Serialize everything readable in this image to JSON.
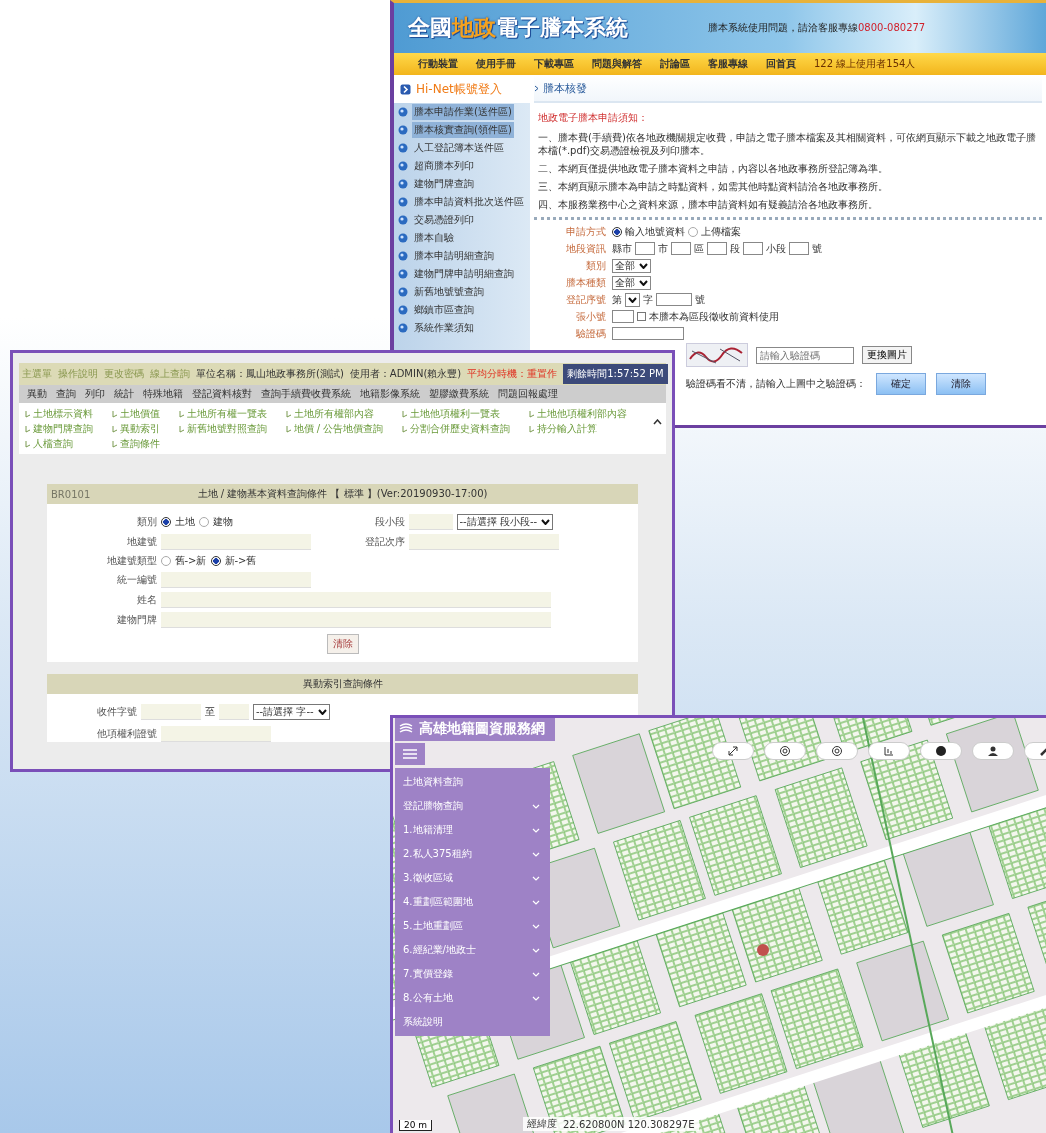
{
  "ecert_window": {
    "title_parts": [
      {
        "text": "全國",
        "accent": false
      },
      {
        "text": "地政",
        "accent": true
      },
      {
        "text": "電子謄本系統",
        "accent": false
      }
    ],
    "banner_note": "謄本系統使用問題，請洽客服專線",
    "banner_phone": "0800-080277",
    "nav": [
      "行動裝置",
      "使用手冊",
      "下載專區",
      "問題與解答",
      "討論區",
      "客服專線",
      "回首頁"
    ],
    "nav_note": "122 線上使用者154人",
    "login": "Hi-Net帳號登入",
    "sidebar": [
      {
        "label": "謄本申請作業(送件區)",
        "selected": true
      },
      {
        "label": "謄本核實查詢(領件區)",
        "selected": true
      },
      {
        "label": "人工登記簿本送件區",
        "selected": false
      },
      {
        "label": "超商謄本列印",
        "selected": false
      },
      {
        "label": "建物門牌查詢",
        "selected": false
      },
      {
        "label": "謄本申請資料批次送件區",
        "selected": false
      },
      {
        "label": "交易憑證列印",
        "selected": false
      },
      {
        "label": "謄本自驗",
        "selected": false
      },
      {
        "label": "謄本申請明細查詢",
        "selected": false
      },
      {
        "label": "建物門牌申請明細查詢",
        "selected": false
      },
      {
        "label": "新舊地號號查詢",
        "selected": false
      },
      {
        "label": "鄉鎮市區查詢",
        "selected": false
      },
      {
        "label": "系統作業須知",
        "selected": false
      }
    ],
    "breadcrumb": "謄本核發",
    "notice_title": "地政電子謄本申請須知：",
    "notices": [
      "一、謄本費(手續費)依各地政機關規定收費，申請之電子謄本檔案及其相關資料，可依網頁顯示下載之地政電子謄本檔(*.pdf)交易憑證檢視及列印謄本。",
      "二、本網頁僅提供地政電子謄本資料之申請，內容以各地政事務所登記簿為準。",
      "三、本網頁顯示謄本為申請之時點資料，如需其他時點資料請洽各地政事務所。",
      "四、本服務業務中心之資料來源，謄本申請資料如有疑義請洽各地政事務所。"
    ],
    "form": {
      "method_label": "申請方式",
      "method_options": [
        {
          "label": "輸入地號資料",
          "selected": true
        },
        {
          "label": "上傳檔案",
          "selected": false
        }
      ],
      "location_label": "地段資訊",
      "location_prefix": "縣市",
      "location_units": [
        "市",
        "區",
        "段",
        "小段",
        "號"
      ],
      "category_label": "類別",
      "category_value": "全部",
      "kind_label": "謄本種類",
      "kind_value": "全部",
      "serial_label": "登記序號",
      "serial_prefix": "第",
      "serial_mid": "字",
      "serial_suffix": "號",
      "number_label": "張小號",
      "partition_option": {
        "label": "本謄本為區段徵收前資料使用",
        "checked": false
      },
      "code_label": "驗證碼",
      "captcha_placeholder": "請輸入驗證碼",
      "refresh_button": "更換圖片",
      "hint": "驗證碼看不清，請輸入上圖中之驗證碼：",
      "buttons": [
        "確定",
        "清除"
      ]
    }
  },
  "query_window": {
    "top_links": [
      "主選單",
      "操作說明",
      "更改密碼",
      "線上查詢"
    ],
    "unit": "單位名稱：鳳山地政事務所(測試)",
    "user": "使用者：ADMIN(賴永豐)",
    "alert": "平均分時機：重置作",
    "timer": "剩餘時間1:57:52 PM",
    "menu": [
      "異動",
      "查詢",
      "列印",
      "統計",
      "特殊地籍",
      "登記資料核對",
      "查詢手續費收費系統",
      "地籍影像系統",
      "塑膠繳費系統",
      "問題回報處理"
    ],
    "links": [
      "土地標示資料",
      "土地價值",
      "土地所有權一覽表",
      "土地所有權部內容",
      "土地他項權利一覽表",
      "土地他項權利部內容",
      "建物門牌查詢",
      "異動索引",
      "新舊地號對照查詢",
      "地價 / 公告地價查詢",
      "分割合併歷史資料查詢",
      "持分輸入計算",
      "人檔查詢",
      "查詢條件"
    ],
    "basic_panel": {
      "code": "BR0101",
      "title": "土地 / 建物基本資料查詢條件 【 標準 】(Ver:20190930-17:00)",
      "type_label": "類別",
      "type_options": [
        {
          "label": "土地",
          "selected": true
        },
        {
          "label": "建物",
          "selected": false
        }
      ],
      "section_label": "段小段",
      "section_select": "--請選擇 段小段--",
      "number_label": "地建號",
      "order_label": "登記次序",
      "number_type_label": "地建號類型",
      "number_type_options": [
        {
          "label": "舊->新",
          "selected": false
        },
        {
          "label": "新->舊",
          "selected": true
        }
      ],
      "id_label": "統一編號",
      "name_label": "姓名",
      "address_label": "建物門牌",
      "clear_button": "清除"
    },
    "index_panel": {
      "title": "異動索引查詢條件",
      "receipt_label": "收件字號",
      "receipt_to": "至",
      "word_select": "--請選擇 字--",
      "right_label": "他項權利證號"
    }
  },
  "map_window": {
    "title": "高雄地籍圖資服務網",
    "menu": [
      {
        "label": "土地資料查詢",
        "expandable": false
      },
      {
        "label": "登記謄物查詢",
        "expandable": true
      },
      {
        "label": "1.地籍清理",
        "expandable": true
      },
      {
        "label": "2.私人375租約",
        "expandable": true
      },
      {
        "label": "3.徵收區域",
        "expandable": true
      },
      {
        "label": "4.重劃區範圍地",
        "expandable": true
      },
      {
        "label": "5.土地重劃區",
        "expandable": true
      },
      {
        "label": "6.經紀業/地政士",
        "expandable": true
      },
      {
        "label": "7.實價登錄",
        "expandable": true
      },
      {
        "label": "8.公有土地",
        "expandable": true
      },
      {
        "label": "系統說明",
        "expandable": false
      }
    ],
    "scale": "20 m",
    "coords_label": "經緯度",
    "coords": "22.620800N 120.308297E"
  }
}
